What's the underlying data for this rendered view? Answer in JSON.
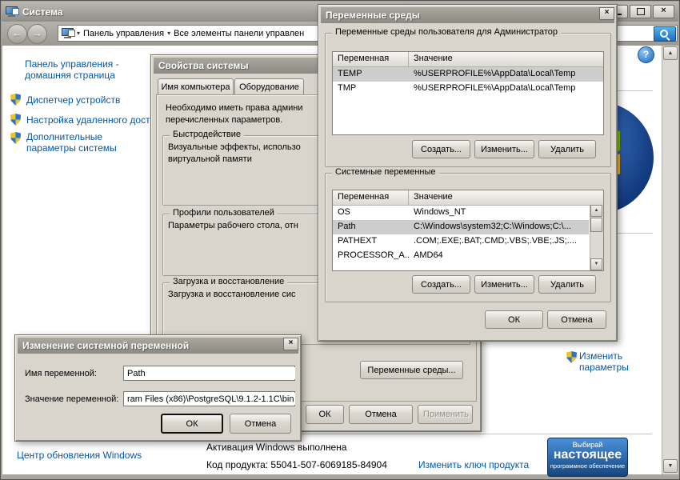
{
  "colors": {
    "link_blue": "#0057ae",
    "selection_grey": "#cdcdcd",
    "badge_blue": "#16467e",
    "title_grey": "#8d8a83"
  },
  "icons": {
    "close": "×",
    "back": "←",
    "forward": "→",
    "dropdown": "▾",
    "help": "?",
    "scroll_up": "▲",
    "scroll_down": "▼"
  },
  "window": {
    "title": "Система",
    "breadcrumb": {
      "root": "Панель управления",
      "current": "Все элементы панели управлен"
    },
    "sidebar": {
      "home": "Панель управления - домашняя страница",
      "tasks": [
        "Диспетчер устройств",
        "Настройка удаленного доступа",
        "Дополнительные параметры системы"
      ],
      "update_link": "Центр обновления Windows"
    },
    "main": {
      "change_settings": "Изменить параметры",
      "activation": "Активация Windows выполнена",
      "product_label": "Код продукта:",
      "product_code": "55041-507-6069185-84904",
      "change_key": "Изменить ключ продукта",
      "badge": {
        "line1": "Выбирай",
        "line2": "настоящее",
        "line3": "программное обеспечение"
      }
    }
  },
  "sysprops": {
    "title": "Свойства системы",
    "tab1": "Имя компьютера",
    "tab2": "Оборудование",
    "intro1": "Необходимо иметь права админи",
    "intro2": "перечисленных параметров.",
    "g1_title": "Быстродействие",
    "g1_text1": "Визуальные эффекты, использо",
    "g1_text2": "виртуальной памяти",
    "g2_title": "Профили пользователей",
    "g2_text": "Параметры рабочего стола, отн",
    "g3_title": "Загрузка и восстановление",
    "g3_text": "Загрузка и восстановление сис",
    "env_btn": "Переменные среды...",
    "ok": "ОК",
    "cancel": "Отмена",
    "apply": "Применить"
  },
  "envdlg": {
    "title": "Переменные среды",
    "user_group": "Переменные среды пользователя для Администратор",
    "sys_group": "Системные переменные",
    "col_var": "Переменная",
    "col_val": "Значение",
    "user_rows": [
      {
        "name": "TEMP",
        "value": "%USERPROFILE%\\AppData\\Local\\Temp"
      },
      {
        "name": "TMP",
        "value": "%USERPROFILE%\\AppData\\Local\\Temp"
      }
    ],
    "sys_rows": [
      {
        "name": "OS",
        "value": "Windows_NT"
      },
      {
        "name": "Path",
        "value": "C:\\Windows\\system32;C:\\Windows;C:\\..."
      },
      {
        "name": "PATHEXT",
        "value": ".COM;.EXE;.BAT;.CMD;.VBS;.VBE;.JS;...."
      },
      {
        "name": "PROCESSOR_A...",
        "value": "AMD64"
      }
    ],
    "btn_new": "Создать...",
    "btn_edit": "Изменить...",
    "btn_delete": "Удалить",
    "ok": "ОК",
    "cancel": "Отмена"
  },
  "editdlg": {
    "title": "Изменение системной переменной",
    "name_label": "Имя переменной:",
    "name_value": "Path",
    "value_label": "Значение переменной:",
    "value_value": "ram Files (x86)\\PostgreSQL\\9.1.2-1.1C\\bin",
    "ok": "ОК",
    "cancel": "Отмена"
  }
}
